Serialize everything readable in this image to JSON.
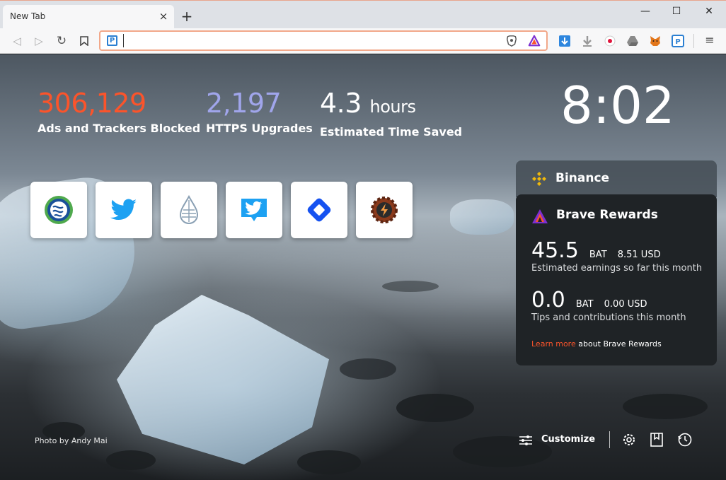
{
  "browser": {
    "tab_title": "New Tab",
    "tab_close": "×",
    "new_tab": "+",
    "window_minimize": "—",
    "window_maximize": "☐",
    "window_close": "✕",
    "back": "◁",
    "forward": "▷",
    "reload": "↻",
    "url_value": "",
    "url_placeholder": "",
    "menu": "≡"
  },
  "stats": {
    "ads_blocked": {
      "value": "306,129",
      "label": "Ads and Trackers Blocked",
      "color": "#fb542b"
    },
    "https_upgrades": {
      "value": "2,197",
      "label": "HTTPS Upgrades",
      "color": "#a0a5eb"
    },
    "time_saved": {
      "value": "4.3",
      "unit": "hours",
      "label": "Estimated Time Saved"
    }
  },
  "clock": "8:02",
  "top_sites": [
    {
      "icon": "steem-icon"
    },
    {
      "icon": "twitter-icon"
    },
    {
      "icon": "drop-icon"
    },
    {
      "icon": "tweetdeck-icon"
    },
    {
      "icon": "diamond-icon"
    },
    {
      "icon": "gear-bolt-icon"
    }
  ],
  "binance": {
    "title": "Binance"
  },
  "rewards": {
    "title": "Brave Rewards",
    "earnings": {
      "amount": "45.5",
      "currency": "BAT",
      "usd": "8.51 USD",
      "desc": "Estimated earnings so far this month"
    },
    "tips": {
      "amount": "0.0",
      "currency": "BAT",
      "usd": "0.00 USD",
      "desc": "Tips and contributions this month"
    },
    "learn_more": "Learn more",
    "learn_rest": "about Brave Rewards"
  },
  "photo_credit": "Photo by Andy Mai",
  "footer": {
    "customize": "Customize"
  }
}
